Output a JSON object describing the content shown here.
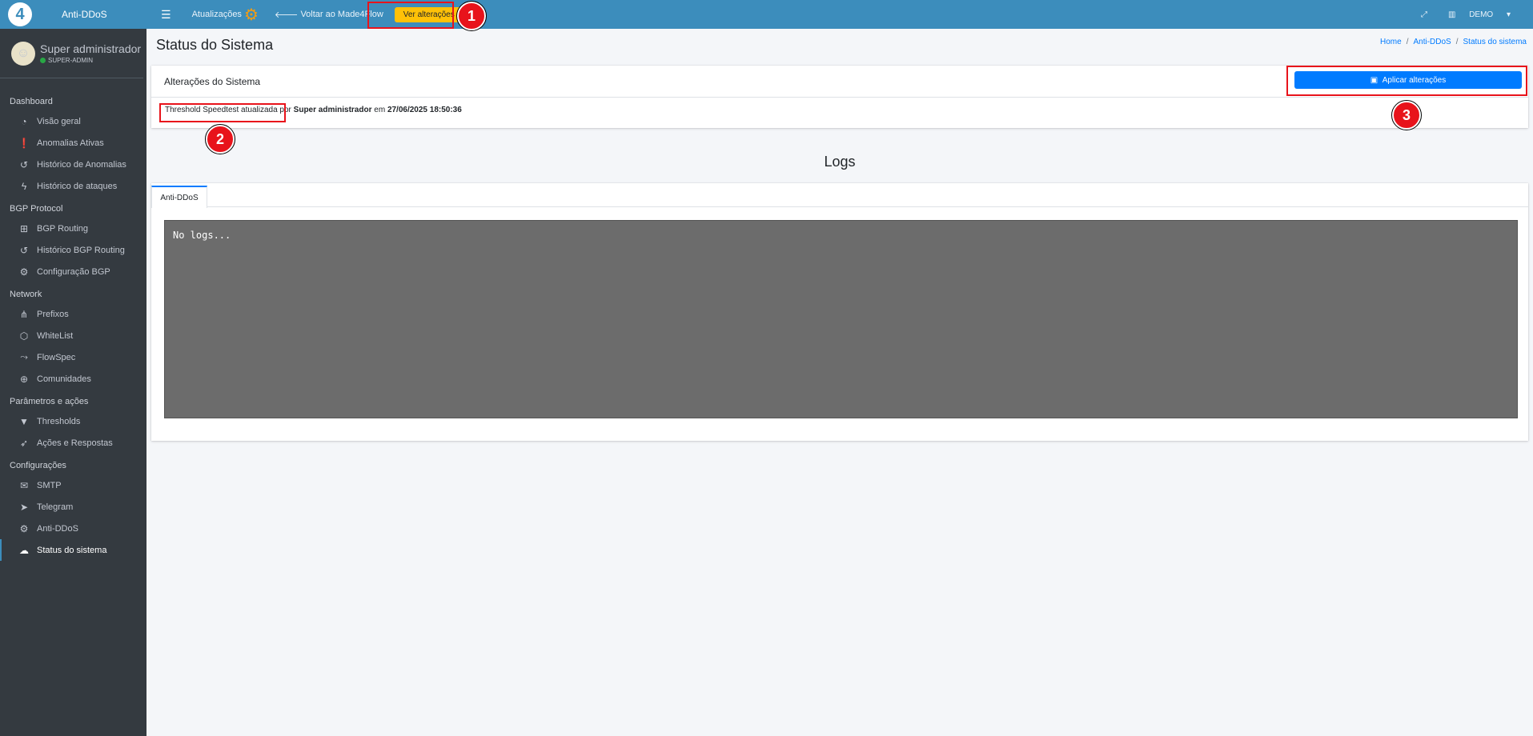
{
  "sidebar": {
    "brand": "Anti-DDoS",
    "user_name": "Super administrador",
    "user_role": "SUPER-ADMIN",
    "sections": [
      {
        "header": "Dashboard",
        "items": [
          {
            "label": "Visão geral",
            "icon": "tachometer-icon"
          },
          {
            "label": "Anomalias Ativas",
            "icon": "exclamation-icon"
          },
          {
            "label": "Histórico de Anomalias",
            "icon": "history-icon"
          },
          {
            "label": "Histórico de ataques",
            "icon": "bolt-icon"
          }
        ]
      },
      {
        "header": "BGP Protocol",
        "items": [
          {
            "label": "BGP Routing",
            "icon": "sitemap-icon"
          },
          {
            "label": "Histórico BGP Routing",
            "icon": "history-icon"
          },
          {
            "label": "Configuração BGP",
            "icon": "gear-icon"
          }
        ]
      },
      {
        "header": "Network",
        "items": [
          {
            "label": "Prefixos",
            "icon": "network-icon"
          },
          {
            "label": "WhiteList",
            "icon": "shield-icon"
          },
          {
            "label": "FlowSpec",
            "icon": "route-icon"
          },
          {
            "label": "Comunidades",
            "icon": "globe-icon"
          }
        ]
      },
      {
        "header": "Parâmetros e ações",
        "items": [
          {
            "label": "Thresholds",
            "icon": "filter-icon"
          },
          {
            "label": "Ações e Respostas",
            "icon": "rocket-icon"
          }
        ]
      },
      {
        "header": "Configurações",
        "items": [
          {
            "label": "SMTP",
            "icon": "mail-server-icon"
          },
          {
            "label": "Telegram",
            "icon": "telegram-icon"
          },
          {
            "label": "Anti-DDoS",
            "icon": "gears-icon"
          },
          {
            "label": "Status do sistema",
            "icon": "cloud-upload-icon",
            "active": true
          }
        ]
      }
    ]
  },
  "topbar": {
    "updates": "Atualizações",
    "back": "Voltar ao Made4Flow",
    "view_changes": "Ver alterações",
    "account": "DEMO"
  },
  "page": {
    "title": "Status do Sistema",
    "breadcrumb": [
      "Home",
      "Anti-DDoS",
      "Status do sistema"
    ]
  },
  "changes_card": {
    "header": "Alterações do Sistema",
    "apply_button": "Aplicar alterações",
    "entry_text": "Threshold Speedtest atualizada",
    "entry_by": " por ",
    "entry_user": "Super administrador",
    "entry_on": " em ",
    "entry_time": "27/06/2025 18:50:36"
  },
  "logs": {
    "title": "Logs",
    "tab": "Anti-DDoS",
    "content": "No logs..."
  },
  "annotations": [
    "1",
    "2",
    "3"
  ],
  "colors": {
    "topbar": "#3c8dbc",
    "sidebar": "#343a40",
    "warning": "#ffc107",
    "primary": "#007bff",
    "annotation": "#e8131b"
  }
}
